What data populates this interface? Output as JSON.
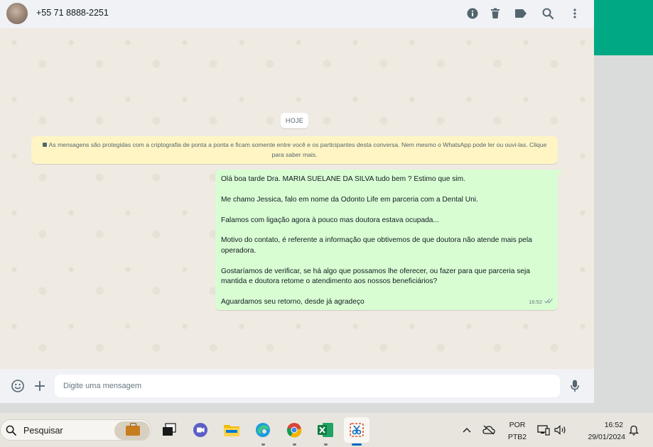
{
  "header": {
    "contact": "+55 71 8888-2251"
  },
  "chat": {
    "date_chip": "HOJE",
    "encryption_notice": "As mensagens são protegidas com a criptografia de ponta a ponta e ficam somente entre você e os participantes desta conversa. Nem mesmo o WhatsApp pode ler ou ouvi-las. Clique para saber mais.",
    "message": {
      "lines": [
        "Olá boa tarde Dra. MARIA SUELANE DA SILVA tudo bem ? Estimo que sim.",
        "Me chamo Jessica, falo em nome da Odonto Life em parceria com a Dental Uni.",
        "Falamos com ligação agora à pouco mas doutora estava ocupada...",
        "Motivo do contato, é referente a informação que obtivemos de que doutora não atende mais pela operadora.",
        "Gostaríamos de verificar, se há algo que possamos lhe oferecer, ou fazer para que parceria seja mantida e doutora retome o atendimento aos nossos beneficiários?",
        "Aguardamos seu retorno, desde já agradeço"
      ],
      "time": "16:52",
      "status_icon": "double-check-icon"
    }
  },
  "composer": {
    "placeholder": "Digite uma mensagem"
  },
  "taskbar": {
    "search_label": "Pesquisar",
    "language_line1": "POR",
    "language_line2": "PTB2",
    "clock_time": "16:52",
    "clock_date": "29/01/2024"
  },
  "colors": {
    "accent": "#00a884",
    "bubble_out": "#d9fdd3",
    "notice_bg": "#fff5c4",
    "chat_bg": "#efeae2"
  }
}
